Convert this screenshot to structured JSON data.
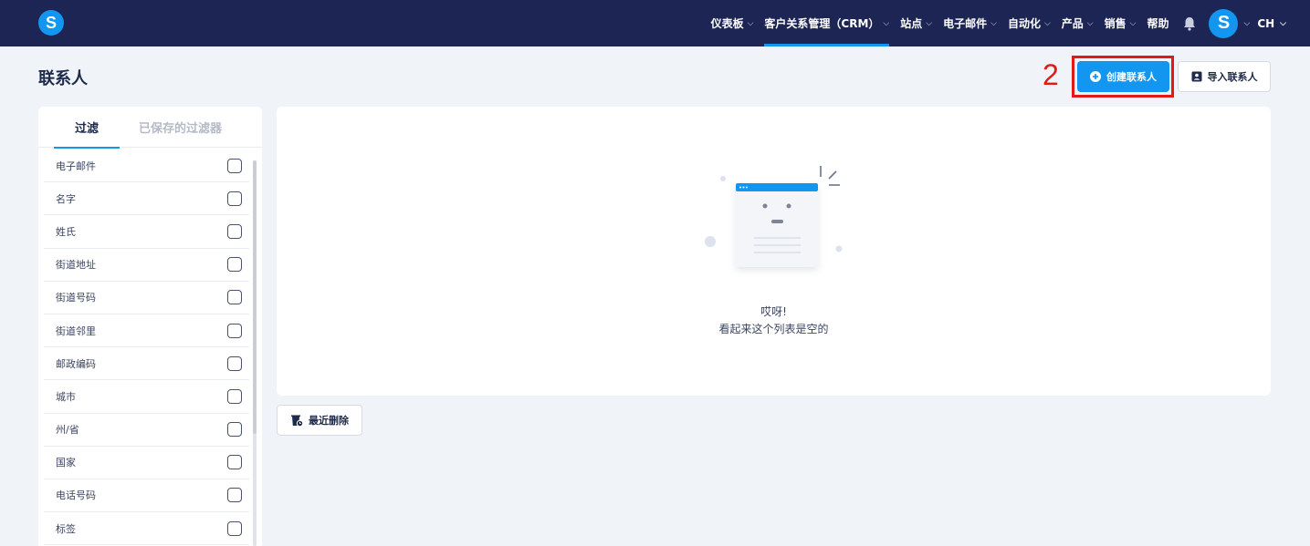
{
  "app": {
    "logo_letter": "S"
  },
  "nav": {
    "items": [
      {
        "label": "仪表板",
        "has_dropdown": true
      },
      {
        "label": "客户关系管理（CRM）",
        "has_dropdown": true,
        "active": true
      },
      {
        "label": "站点",
        "has_dropdown": true
      },
      {
        "label": "电子邮件",
        "has_dropdown": true
      },
      {
        "label": "自动化",
        "has_dropdown": true
      },
      {
        "label": "产品",
        "has_dropdown": true
      },
      {
        "label": "销售",
        "has_dropdown": true
      },
      {
        "label": "帮助",
        "has_dropdown": false
      }
    ],
    "avatar_letter": "S",
    "language": "CH",
    "chevron": "⌵"
  },
  "header": {
    "title": "联系人",
    "step_number": "2",
    "create_button": "创建联系人",
    "import_button": "导入联系人"
  },
  "filters": {
    "tab_active": "过滤",
    "tab_saved": "已保存的过滤器",
    "fields": [
      "电子邮件",
      "名字",
      "姓氏",
      "街道地址",
      "街道号码",
      "街道邻里",
      "邮政编码",
      "城市",
      "州/省",
      "国家",
      "电话号码",
      "标签"
    ]
  },
  "empty_state": {
    "title": "哎呀!",
    "subtitle": "看起来这个列表是空的"
  },
  "recent_delete_button": "最近删除",
  "colors": {
    "nav_bg": "#1c2553",
    "accent": "#1396f0",
    "highlight": "#e11919",
    "page_bg": "#f0f3f7"
  }
}
